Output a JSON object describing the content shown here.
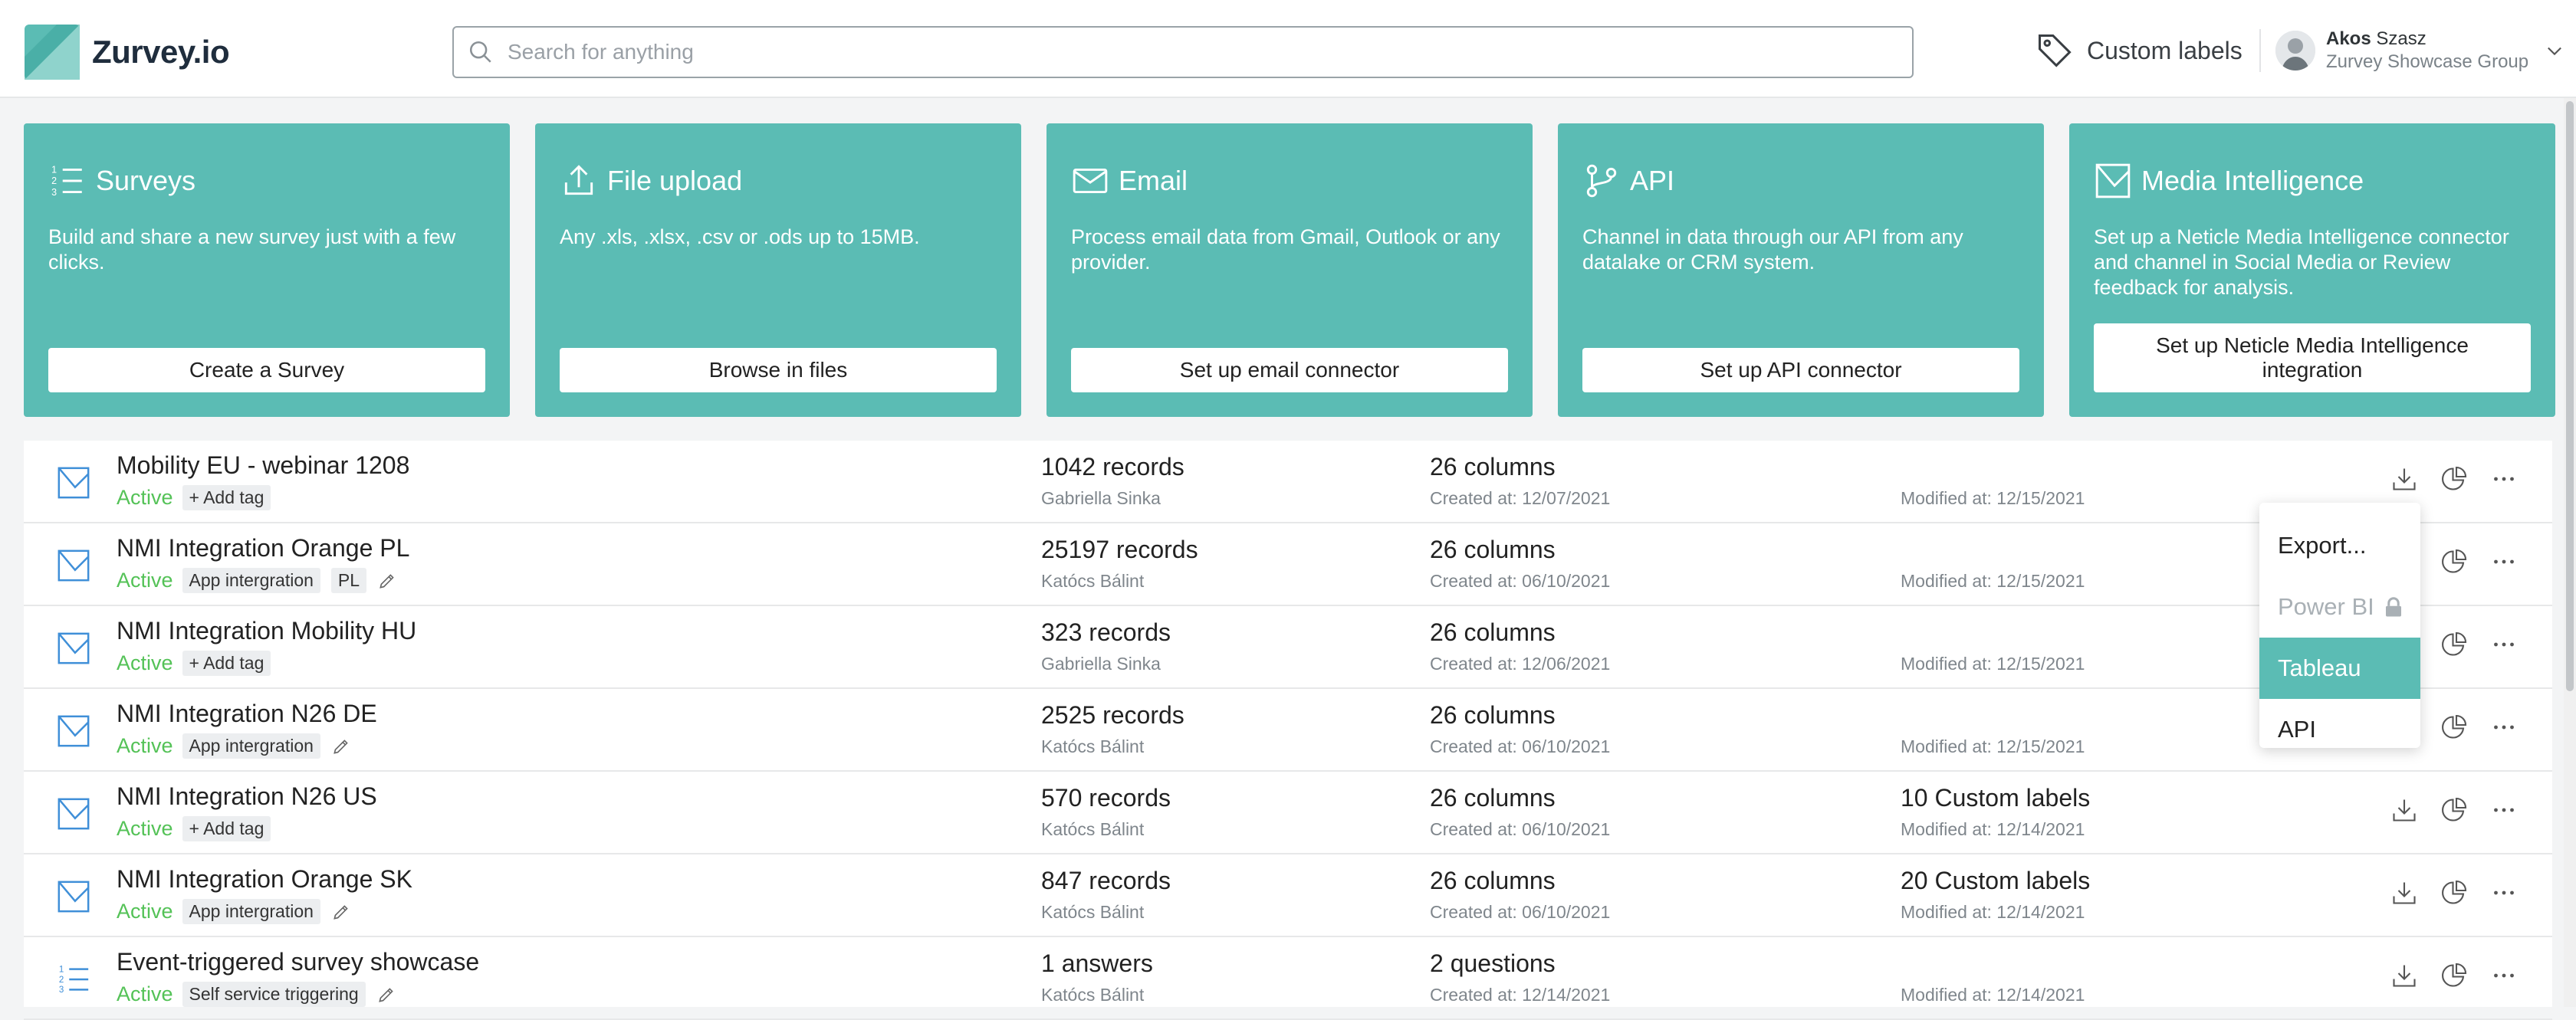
{
  "app": {
    "name": "Zurvey.io",
    "brand_color": "#5bbcb4"
  },
  "search": {
    "placeholder": "Search for anything"
  },
  "header": {
    "custom_labels": "Custom labels",
    "user_first": "Akos",
    "user_last": "Szasz",
    "user_org": "Zurvey Showcase Group"
  },
  "cards": [
    {
      "title": "Surveys",
      "icon": "list-numbered-icon",
      "desc": "Build and share a new survey just with a few clicks.",
      "button": "Create a Survey"
    },
    {
      "title": "File upload",
      "icon": "upload-icon",
      "desc": "Any .xls, .xlsx, .csv or .ods up to 15MB.",
      "button": "Browse in files"
    },
    {
      "title": "Email",
      "icon": "email-icon",
      "desc": "Process email data from Gmail, Outlook or any provider.",
      "button": "Set up email connector"
    },
    {
      "title": "API",
      "icon": "api-branch-icon",
      "desc": "Channel in data through our API from any datalake or CRM system.",
      "button": "Set up API connector"
    },
    {
      "title": "Media Intelligence",
      "icon": "media-intelligence-icon",
      "desc": "Set up a Neticle Media Intelligence connector and channel in Social Media or Review feedback for analysis.",
      "button": "Set up Neticle Media Intelligence integration"
    }
  ],
  "rows": [
    {
      "name": "Mobility EU - webinar 1208",
      "status": "Active",
      "tags": [
        "+ Add tag"
      ],
      "edit": false,
      "records": "1042 records",
      "owner": "Gabriella Sinka",
      "columns": "26 columns",
      "created": "Created at: 12/07/2021",
      "labels": "",
      "modified": "Modified at: 12/15/2021",
      "icon": "neticle-icon"
    },
    {
      "name": "NMI Integration Orange PL",
      "status": "Active",
      "tags": [
        "App intergration",
        "PL"
      ],
      "edit": true,
      "records": "25197 records",
      "owner": "Katócs Bálint",
      "columns": "26 columns",
      "created": "Created at: 06/10/2021",
      "labels": "",
      "modified": "Modified at: 12/15/2021",
      "icon": "neticle-icon"
    },
    {
      "name": "NMI Integration Mobility HU",
      "status": "Active",
      "tags": [
        "+ Add tag"
      ],
      "edit": false,
      "records": "323 records",
      "owner": "Gabriella Sinka",
      "columns": "26 columns",
      "created": "Created at: 12/06/2021",
      "labels": "",
      "modified": "Modified at: 12/15/2021",
      "icon": "neticle-icon"
    },
    {
      "name": "NMI Integration N26 DE",
      "status": "Active",
      "tags": [
        "App intergration"
      ],
      "edit": true,
      "records": "2525 records",
      "owner": "Katócs Bálint",
      "columns": "26 columns",
      "created": "Created at: 06/10/2021",
      "labels": "",
      "modified": "Modified at: 12/15/2021",
      "icon": "neticle-icon"
    },
    {
      "name": "NMI Integration N26 US",
      "status": "Active",
      "tags": [
        "+ Add tag"
      ],
      "edit": false,
      "records": "570 records",
      "owner": "Katócs Bálint",
      "columns": "26 columns",
      "created": "Created at: 06/10/2021",
      "labels": "10 Custom labels",
      "modified": "Modified at: 12/14/2021",
      "icon": "neticle-icon"
    },
    {
      "name": "NMI Integration Orange SK",
      "status": "Active",
      "tags": [
        "App intergration"
      ],
      "edit": true,
      "records": "847 records",
      "owner": "Katócs Bálint",
      "columns": "26 columns",
      "created": "Created at: 06/10/2021",
      "labels": "20 Custom labels",
      "modified": "Modified at: 12/14/2021",
      "icon": "neticle-icon"
    },
    {
      "name": "Event-triggered survey showcase",
      "status": "Active",
      "tags": [
        "Self service triggering"
      ],
      "edit": true,
      "records": "1 answers",
      "owner": "Katócs Bálint",
      "columns": "2 questions",
      "created": "Created at: 12/14/2021",
      "labels": "",
      "modified": "Modified at: 12/14/2021",
      "icon": "survey-list-icon"
    }
  ],
  "export_menu": {
    "items": [
      {
        "label": "Export...",
        "state": "normal"
      },
      {
        "label": "Power BI",
        "state": "disabled"
      },
      {
        "label": "Tableau",
        "state": "active"
      },
      {
        "label": "API",
        "state": "normal"
      }
    ]
  }
}
